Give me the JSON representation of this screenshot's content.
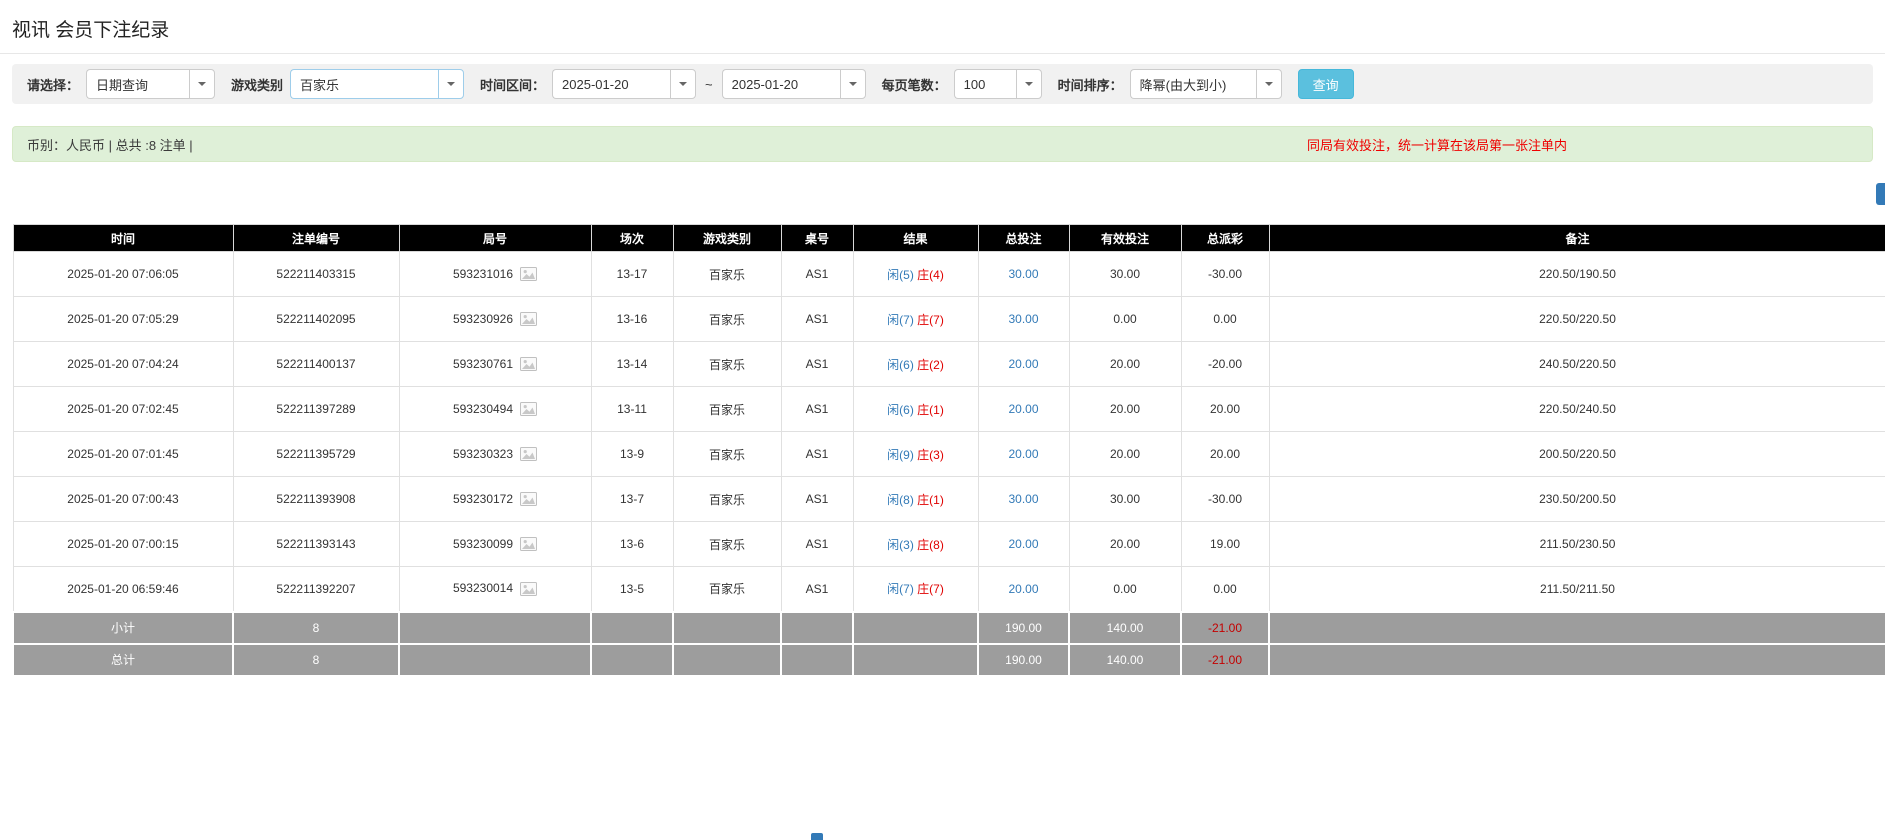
{
  "page": {
    "title": "视讯 会员下注纪录"
  },
  "filter": {
    "select_label": "请选择：",
    "select_value": "日期查询",
    "game_label": "游戏类别",
    "game_value": "百家乐",
    "range_label": "时间区间：",
    "date_from": "2025-01-20",
    "tilde": "~",
    "date_to": "2025-01-20",
    "per_page_label": "每页笔数：",
    "per_page_value": "100",
    "sort_label": "时间排序：",
    "sort_value": "降幂(由大到小)",
    "search_label": "查询"
  },
  "notice": {
    "left": "币别：人民币 | 总共 :8 注单 |",
    "right": "同局有效投注，统一计算在该局第一张注单内"
  },
  "table": {
    "headers": [
      "时间",
      "注单编号",
      "局号",
      "场次",
      "游戏类别",
      "桌号",
      "结果",
      "总投注",
      "有效投注",
      "总派彩",
      "备注"
    ],
    "rows": [
      {
        "time": "2025-01-20 07:06:05",
        "bet_id": "522211403315",
        "round": "593231016",
        "session": "13-17",
        "game": "百家乐",
        "table_no": "AS1",
        "player": "闲(5)",
        "banker": "庄(4)",
        "total_bet": "30.00",
        "valid_bet": "30.00",
        "payout": "-30.00",
        "note": "220.50/190.50"
      },
      {
        "time": "2025-01-20 07:05:29",
        "bet_id": "522211402095",
        "round": "593230926",
        "session": "13-16",
        "game": "百家乐",
        "table_no": "AS1",
        "player": "闲(7)",
        "banker": "庄(7)",
        "total_bet": "30.00",
        "valid_bet": "0.00",
        "payout": "0.00",
        "note": "220.50/220.50"
      },
      {
        "time": "2025-01-20 07:04:24",
        "bet_id": "522211400137",
        "round": "593230761",
        "session": "13-14",
        "game": "百家乐",
        "table_no": "AS1",
        "player": "闲(6)",
        "banker": "庄(2)",
        "total_bet": "20.00",
        "valid_bet": "20.00",
        "payout": "-20.00",
        "note": "240.50/220.50"
      },
      {
        "time": "2025-01-20 07:02:45",
        "bet_id": "522211397289",
        "round": "593230494",
        "session": "13-11",
        "game": "百家乐",
        "table_no": "AS1",
        "player": "闲(6)",
        "banker": "庄(1)",
        "total_bet": "20.00",
        "valid_bet": "20.00",
        "payout": "20.00",
        "note": "220.50/240.50"
      },
      {
        "time": "2025-01-20 07:01:45",
        "bet_id": "522211395729",
        "round": "593230323",
        "session": "13-9",
        "game": "百家乐",
        "table_no": "AS1",
        "player": "闲(9)",
        "banker": "庄(3)",
        "total_bet": "20.00",
        "valid_bet": "20.00",
        "payout": "20.00",
        "note": "200.50/220.50"
      },
      {
        "time": "2025-01-20 07:00:43",
        "bet_id": "522211393908",
        "round": "593230172",
        "session": "13-7",
        "game": "百家乐",
        "table_no": "AS1",
        "player": "闲(8)",
        "banker": "庄(1)",
        "total_bet": "30.00",
        "valid_bet": "30.00",
        "payout": "-30.00",
        "note": "230.50/200.50"
      },
      {
        "time": "2025-01-20 07:00:15",
        "bet_id": "522211393143",
        "round": "593230099",
        "session": "13-6",
        "game": "百家乐",
        "table_no": "AS1",
        "player": "闲(3)",
        "banker": "庄(8)",
        "total_bet": "20.00",
        "valid_bet": "20.00",
        "payout": "19.00",
        "note": "211.50/230.50"
      },
      {
        "time": "2025-01-20 06:59:46",
        "bet_id": "522211392207",
        "round": "593230014",
        "session": "13-5",
        "game": "百家乐",
        "table_no": "AS1",
        "player": "闲(7)",
        "banker": "庄(7)",
        "total_bet": "20.00",
        "valid_bet": "0.00",
        "payout": "0.00",
        "note": "211.50/211.50"
      }
    ],
    "subtotal": {
      "label": "小计",
      "count": "8",
      "total_bet": "190.00",
      "valid_bet": "140.00",
      "payout": "-21.00"
    },
    "total": {
      "label": "总计",
      "count": "8",
      "total_bet": "190.00",
      "valid_bet": "140.00",
      "payout": "-21.00"
    }
  },
  "colors": {
    "accent_blue": "#337ab7",
    "negative_red": "#e00000",
    "success_bg": "#dff0d8",
    "header_bg": "#000000",
    "footer_bg": "#9d9d9d",
    "search_button_bg": "#5bc0de"
  }
}
